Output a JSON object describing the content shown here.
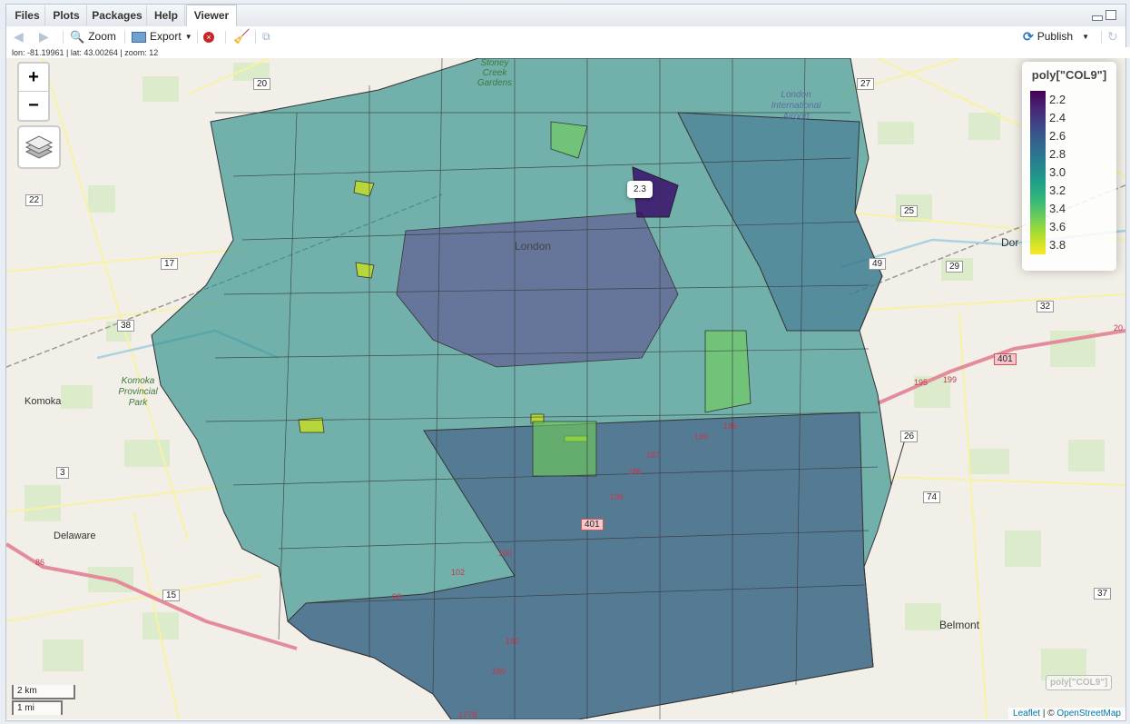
{
  "tabs": [
    {
      "label": "Files",
      "active": false
    },
    {
      "label": "Plots",
      "active": false
    },
    {
      "label": "Packages",
      "active": false
    },
    {
      "label": "Help",
      "active": false
    },
    {
      "label": "Viewer",
      "active": true
    }
  ],
  "toolbar": {
    "zoom_label": "Zoom",
    "export_label": "Export",
    "publish_label": "Publish"
  },
  "status": "lon: -81.19961 | lat: 43.00264 | zoom: 12",
  "map": {
    "zoom_in": "+",
    "zoom_out": "−",
    "popup": "2.3",
    "scale_km": "2 km",
    "scale_mi": "1 mi",
    "attrib_leaflet": "Leaflet",
    "attrib_sep": " | © ",
    "attrib_osm": "OpenStreetMap",
    "ghost_legend": "poly[\"COL9\"]",
    "places": [
      {
        "name": "Komoka"
      },
      {
        "name": "Komoka Provincial Park"
      },
      {
        "name": "Delaware"
      },
      {
        "name": "London"
      },
      {
        "name": "London International Airport"
      },
      {
        "name": "Belmont"
      },
      {
        "name": "Dor"
      },
      {
        "name": "Stoney Creek Gardens"
      }
    ],
    "routes": [
      "20",
      "27",
      "22",
      "25",
      "17",
      "49",
      "29",
      "38",
      "32",
      "401",
      "199",
      "195",
      "26",
      "3",
      "74",
      "15",
      "37",
      "86",
      "185",
      "187",
      "186",
      "189",
      "136",
      "401",
      "100",
      "102",
      "180",
      "180",
      "177B",
      "98",
      "20"
    ]
  },
  "legend": {
    "title": "poly[\"COL9\"]",
    "ticks": [
      "2.2",
      "2.4",
      "2.6",
      "2.8",
      "3.0",
      "3.2",
      "3.4",
      "3.6",
      "3.8"
    ]
  },
  "colors": {
    "viridis_low": "#440154",
    "viridis_mid": "#21918c",
    "viridis_high": "#fde725",
    "accent": "#2f73b9"
  }
}
